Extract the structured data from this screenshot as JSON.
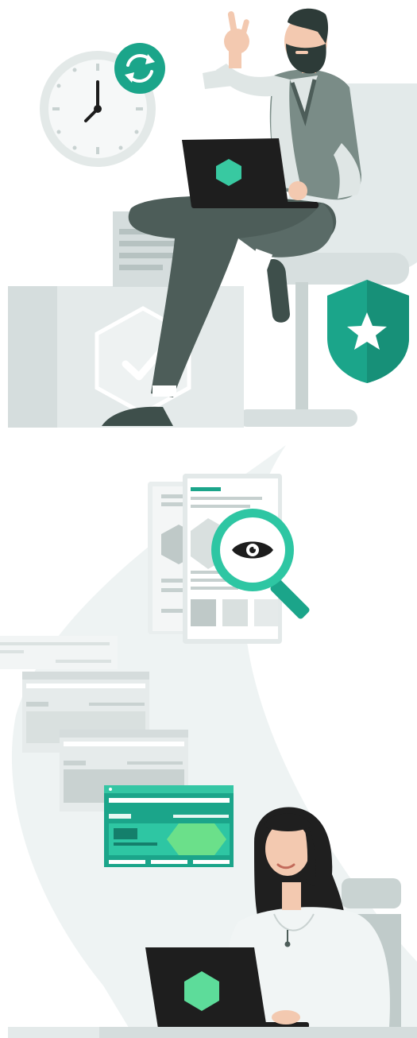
{
  "colors": {
    "background": "#ffffff",
    "swoosh": "#eef3f3",
    "teal": "#1ba58a",
    "teal_light": "#34c6a4",
    "mint": "#5ddc9a",
    "grey_light": "#e8eded",
    "grey_mid": "#c9d3d2",
    "grey_dark": "#4d5d59",
    "skin": "#f3c9b0",
    "hair": "#2d3b38",
    "laptop": "#1e1e1e"
  },
  "illustrations": [
    {
      "id": "clock-icon"
    },
    {
      "id": "refresh-icon"
    },
    {
      "id": "seated-man-with-laptop"
    },
    {
      "id": "shield-star-icon"
    },
    {
      "id": "hexagon-check-icon"
    },
    {
      "id": "magnifier-eye-icon"
    },
    {
      "id": "stacked-report-windows"
    },
    {
      "id": "woman-with-laptop"
    }
  ]
}
